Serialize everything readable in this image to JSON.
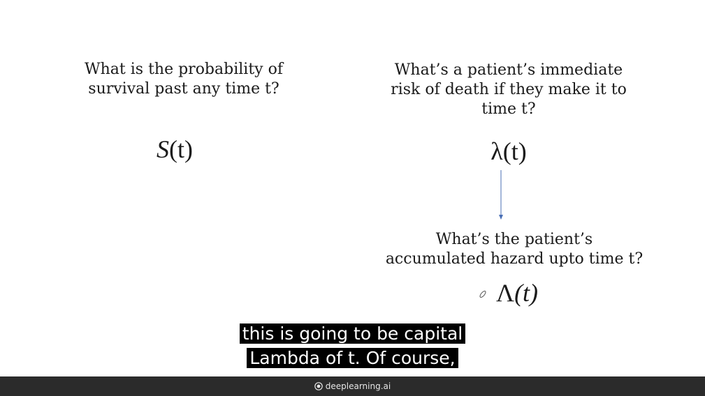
{
  "slide": {
    "survival_question": "What is the probability of\nsurvival past any time t?",
    "survival_formula": {
      "symbol": "S",
      "argument": "(t)"
    },
    "risk_question": "What’s a patient’s immediate\nrisk of death if they make it to\ntime t?",
    "hazard_formula": {
      "symbol": "λ",
      "argument": "(t)"
    },
    "accumulated_question": "What’s the patient’s\naccumulated hazard upto time t?",
    "cumulative_formula": {
      "symbol": "Λ",
      "argument": "(t)"
    }
  },
  "captions": {
    "line1": "this is going to be capital",
    "line2": "Lambda of t. Of course,"
  },
  "footer": {
    "brand": "deeplearning.ai"
  },
  "colors": {
    "text": "#1a1a1a",
    "arrow": "#4a6fb5",
    "caption_bg": "#000000",
    "caption_text": "#ffffff",
    "footer_bg": "#2b2b2b",
    "footer_text": "#e6e6e6"
  },
  "icons": {
    "pen": "pen-cursor-icon",
    "logo": "deeplearning-logo-icon"
  }
}
